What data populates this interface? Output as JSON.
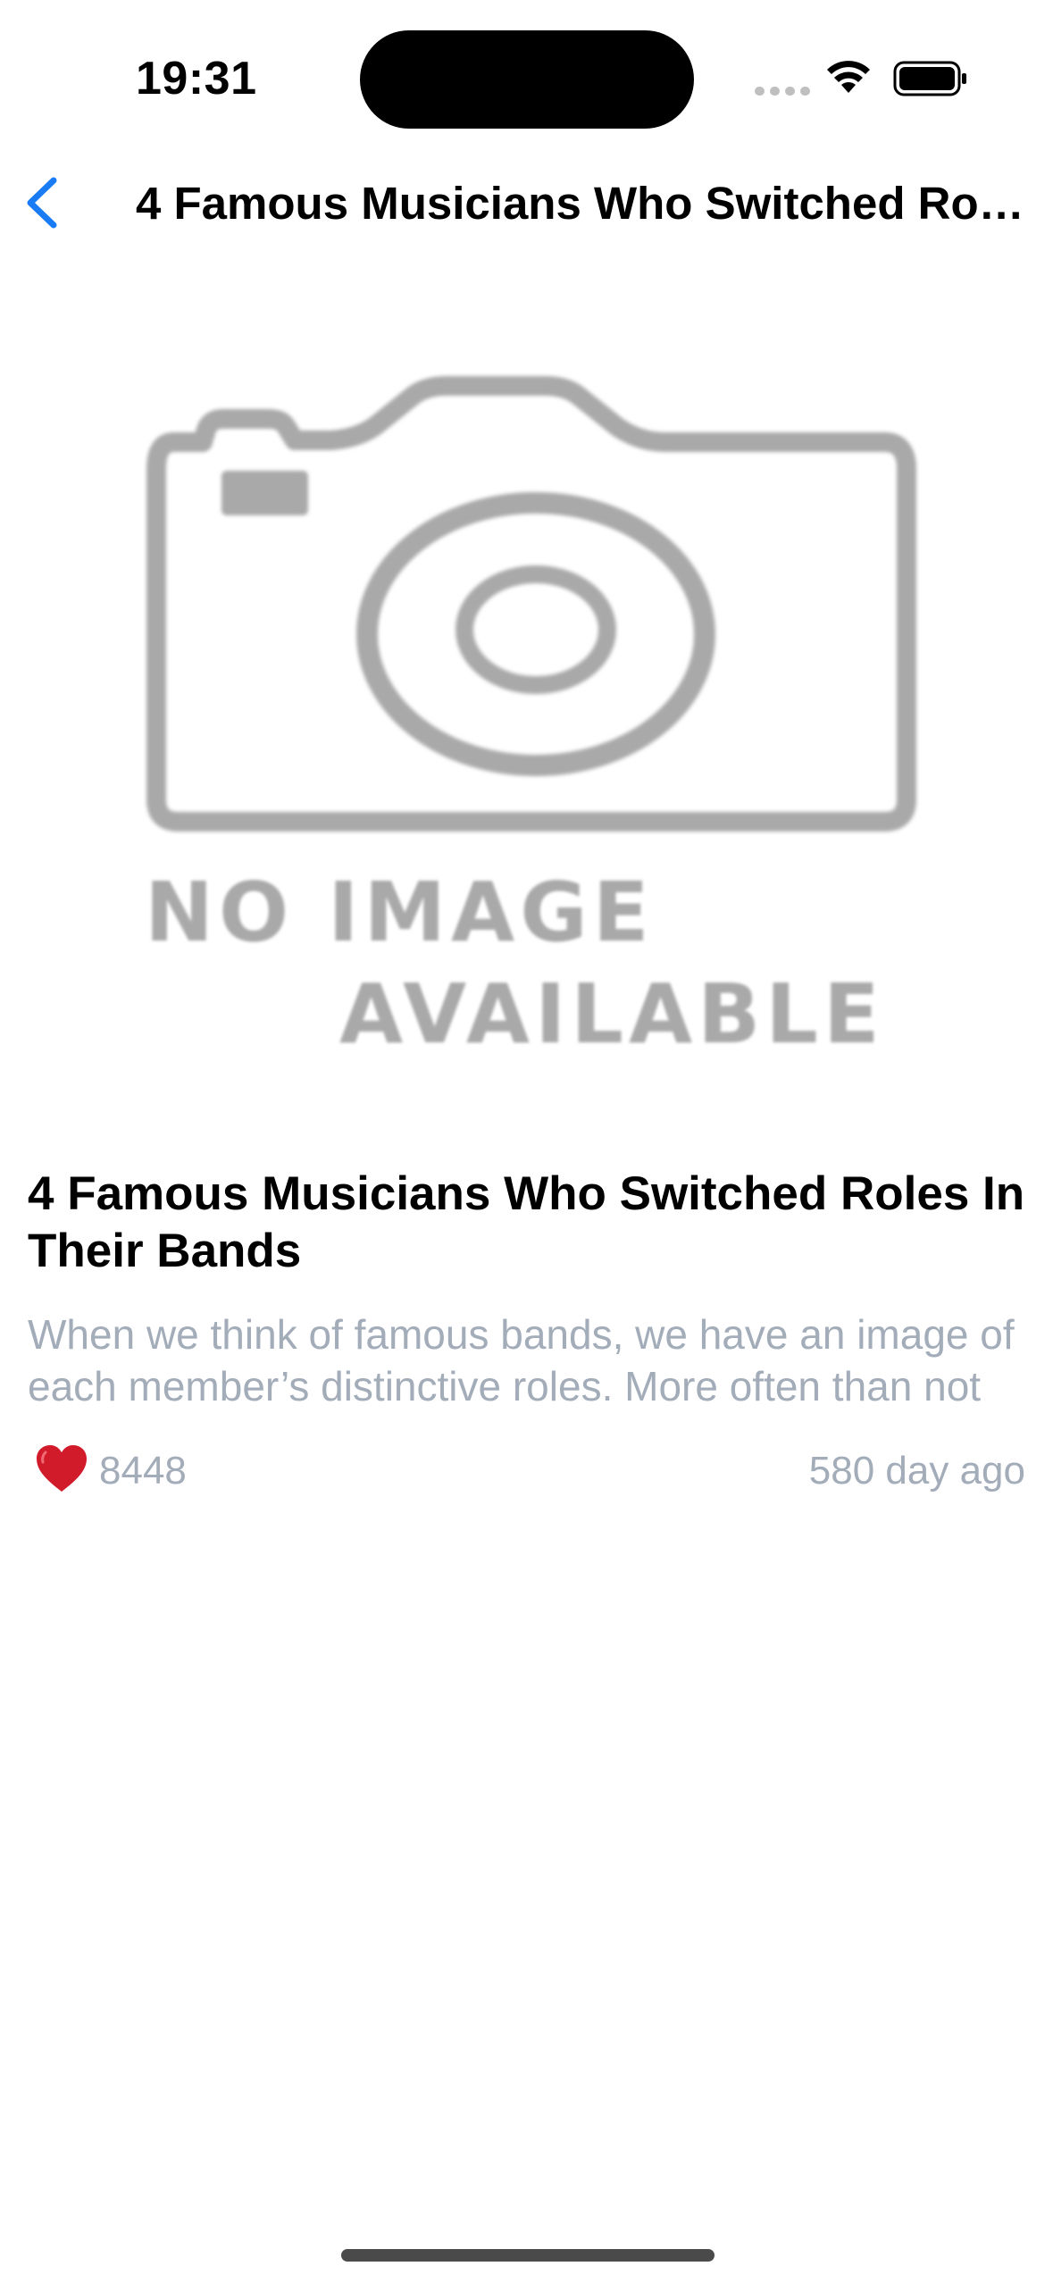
{
  "status_bar": {
    "time": "19:31",
    "icons": [
      "cellular-icon",
      "wifi-icon",
      "battery-icon"
    ]
  },
  "nav": {
    "back_icon": "chevron-left-icon",
    "title": "4 Famous Musicians Who Switched Roles In Their Bands",
    "accent_color": "#1a7cf5"
  },
  "article": {
    "image_placeholder": {
      "line1": "NO IMAGE",
      "line2": "AVAILABLE"
    },
    "title": "4 Famous Musicians Who Switched Roles In Their Bands",
    "summary": "When we think of famous bands, we have an image of each member’s distinctive roles. More often than not",
    "likes": "8448",
    "like_icon": "heart-icon",
    "timestamp": "580 day ago"
  },
  "colors": {
    "secondary_text": "#a3acb9",
    "heart": "#d11a2a",
    "placeholder_gray": "#a9a9a9"
  }
}
